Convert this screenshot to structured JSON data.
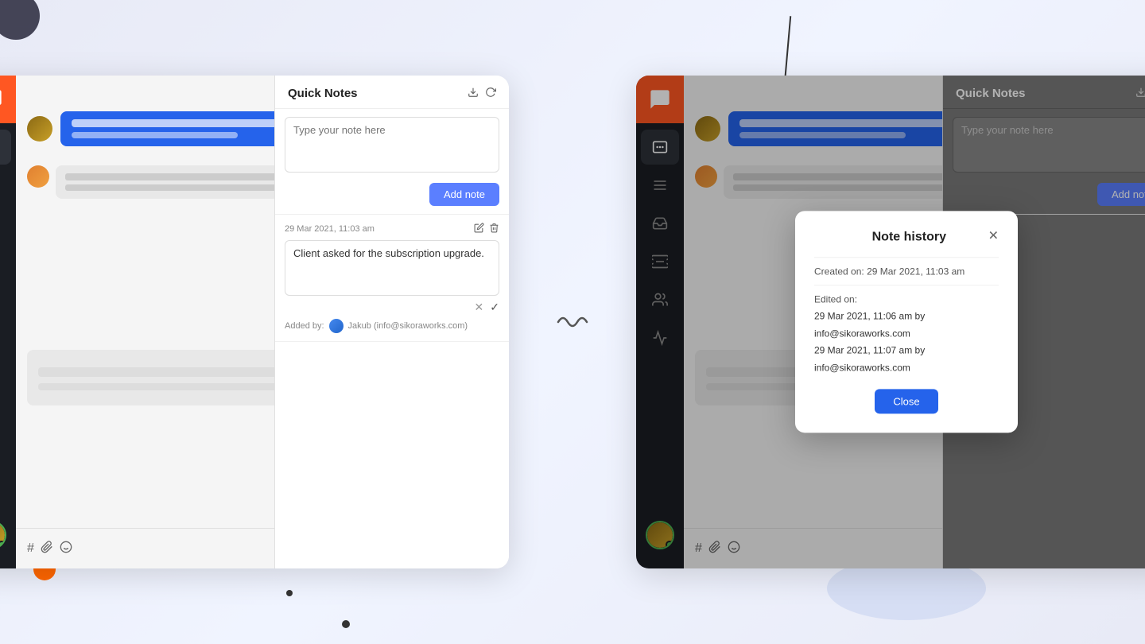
{
  "background": {
    "color": "#e8eaf6"
  },
  "panel1": {
    "sidebar": {
      "logo_icon": "chat-bubble-icon",
      "nav_items": [
        {
          "id": "messages",
          "label": "Messages",
          "active": true
        },
        {
          "id": "list",
          "label": "List",
          "active": false
        },
        {
          "id": "inbox",
          "label": "Inbox",
          "active": false
        },
        {
          "id": "tickets",
          "label": "Tickets",
          "active": false
        },
        {
          "id": "contacts",
          "label": "Contacts",
          "active": false
        },
        {
          "id": "analytics",
          "label": "Analytics",
          "active": false
        }
      ]
    },
    "header": {
      "profile_icon_label": "Profile",
      "notes_icon_label": "Quick Notes"
    },
    "notes_panel": {
      "title": "Quick Notes",
      "textarea_placeholder": "Type your note here",
      "add_button_label": "Add note",
      "note": {
        "date": "29 Mar 2021, 11:03 am",
        "text": "Client asked for the subscription upgrade.",
        "author_label": "Added by:",
        "author_name": "Jakub (info@sikoraworks.com)"
      },
      "download_icon": "download-icon",
      "refresh_icon": "refresh-icon",
      "edit_icon": "edit-icon",
      "delete_icon": "delete-icon",
      "cancel_icon": "cancel-icon",
      "confirm_icon": "confirm-icon"
    }
  },
  "panel2": {
    "sidebar": {
      "logo_icon": "chat-bubble-icon"
    },
    "notes_panel": {
      "title": "Quick Notes",
      "textarea_placeholder": "Type your note here",
      "add_button_label": "Add note"
    },
    "modal": {
      "title": "Note history",
      "created_label": "Created on:",
      "created_date": "29 Mar 2021, 11:03 am",
      "edited_label": "Edited on:",
      "edited_entries": [
        "29 Mar 2021, 11:06 am by info@sikoraworks.com",
        "29 Mar 2021, 11:07 am by info@sikoraworks.com"
      ],
      "close_button_label": "Close"
    }
  }
}
